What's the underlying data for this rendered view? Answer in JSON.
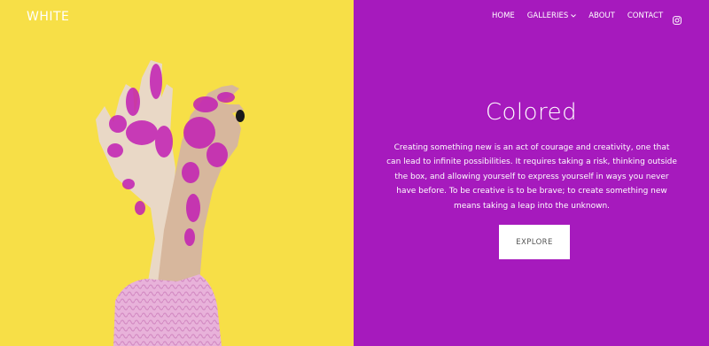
{
  "header": {
    "logo": "WHITE",
    "nav": [
      {
        "label": "HOME"
      },
      {
        "label": "GALLERIES",
        "has_dropdown": true
      },
      {
        "label": "ABOUT"
      },
      {
        "label": "CONTACT"
      }
    ],
    "social_icon": "instagram-icon"
  },
  "hero": {
    "title": "Colored",
    "text": "Creating something new is an act of courage and creativity, one that can lead to infinite possibilities. It requires taking a risk, thinking outside the box, and allowing yourself to express yourself in ways you never have before. To be creative is to be brave; to create something new means taking a leap into the unknown.",
    "button": "EXPLORE"
  },
  "colors": {
    "left_bg": "#f7df47",
    "right_bg": "#a61abd",
    "glitter": "#c21fb4",
    "sweater": "#e6a9d6"
  }
}
